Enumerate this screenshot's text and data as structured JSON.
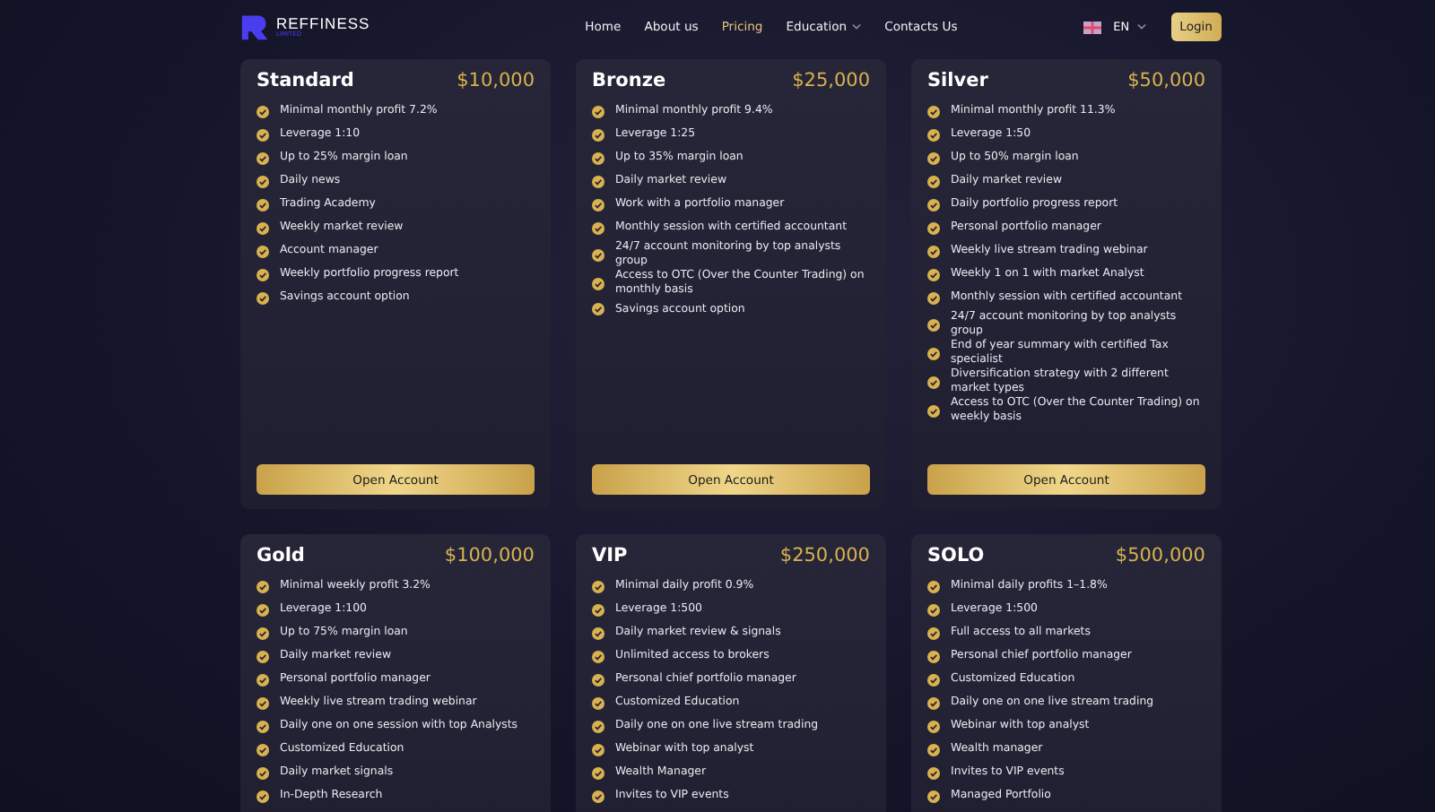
{
  "header": {
    "logo": {
      "name": "REFFINESS",
      "tagline": "LIMITED"
    },
    "nav": [
      {
        "label": "Home",
        "selected": false,
        "dropdown": false
      },
      {
        "label": "About us",
        "selected": false,
        "dropdown": false
      },
      {
        "label": "Pricing",
        "selected": true,
        "dropdown": false
      },
      {
        "label": "Education",
        "selected": false,
        "dropdown": true
      },
      {
        "label": "Contacts Us",
        "selected": false,
        "dropdown": false
      }
    ],
    "language": "EN",
    "login": "Login"
  },
  "plans": [
    {
      "name": "Standard",
      "price": "$10,000",
      "features": [
        "Minimal monthly profit 7.2%",
        "Leverage 1:10",
        "Up to 25% margin loan",
        "Daily news",
        "Trading Academy",
        "Weekly market review",
        "Account manager",
        "Weekly portfolio progress report",
        "Savings account option"
      ],
      "button": "Open Account"
    },
    {
      "name": "Bronze",
      "price": "$25,000",
      "features": [
        "Minimal monthly profit 9.4%",
        "Leverage 1:25",
        "Up to 35% margin loan",
        "Daily market review",
        "Work with a portfolio manager",
        "Monthly session with certified accountant",
        "24/7 account monitoring by top analysts group",
        "Access to OTC (Over the Counter Trading) on monthly basis",
        "Savings account option"
      ],
      "button": "Open Account"
    },
    {
      "name": "Silver",
      "price": "$50,000",
      "features": [
        "Minimal monthly profit 11.3%",
        "Leverage 1:50",
        "Up to 50% margin loan",
        "Daily market review",
        "Daily portfolio progress report",
        "Personal portfolio manager",
        "Weekly live stream trading webinar",
        "Weekly 1 on 1 with market Analyst",
        "Monthly session with certified accountant",
        "24/7 account monitoring by top analysts group",
        "End of year summary with certified Tax specialist",
        "Diversification strategy with 2 different market types",
        "Access to OTC (Over the Counter Trading) on weekly basis"
      ],
      "button": "Open Account"
    },
    {
      "name": "Gold",
      "price": "$100,000",
      "features": [
        "Minimal weekly profit 3.2%",
        "Leverage 1:100",
        "Up to 75% margin loan",
        "Daily market review",
        "Personal portfolio manager",
        "Weekly live stream trading webinar",
        "Daily one on one session with top Analysts",
        "Customized Education",
        "Daily market signals",
        "In-Depth Research"
      ]
    },
    {
      "name": "VIP",
      "price": "$250,000",
      "features": [
        "Minimal daily profit 0.9%",
        "Leverage 1:500",
        "Daily market review & signals",
        "Unlimited access to brokers",
        "Personal chief portfolio manager",
        "Customized Education",
        "Daily one on one live stream trading",
        "Webinar with top analyst",
        "Wealth Manager",
        "Invites to VIP events"
      ]
    },
    {
      "name": "SOLO",
      "price": "$500,000",
      "features": [
        "Minimal daily profits 1–1.8%",
        "Leverage 1:500",
        "Full access to all markets",
        "Personal chief portfolio manager",
        "Customized Education",
        "Daily one on one live stream trading",
        "Webinar with top analyst",
        "Wealth manager",
        "Invites to VIP events",
        "Managed Portfolio"
      ]
    }
  ]
}
